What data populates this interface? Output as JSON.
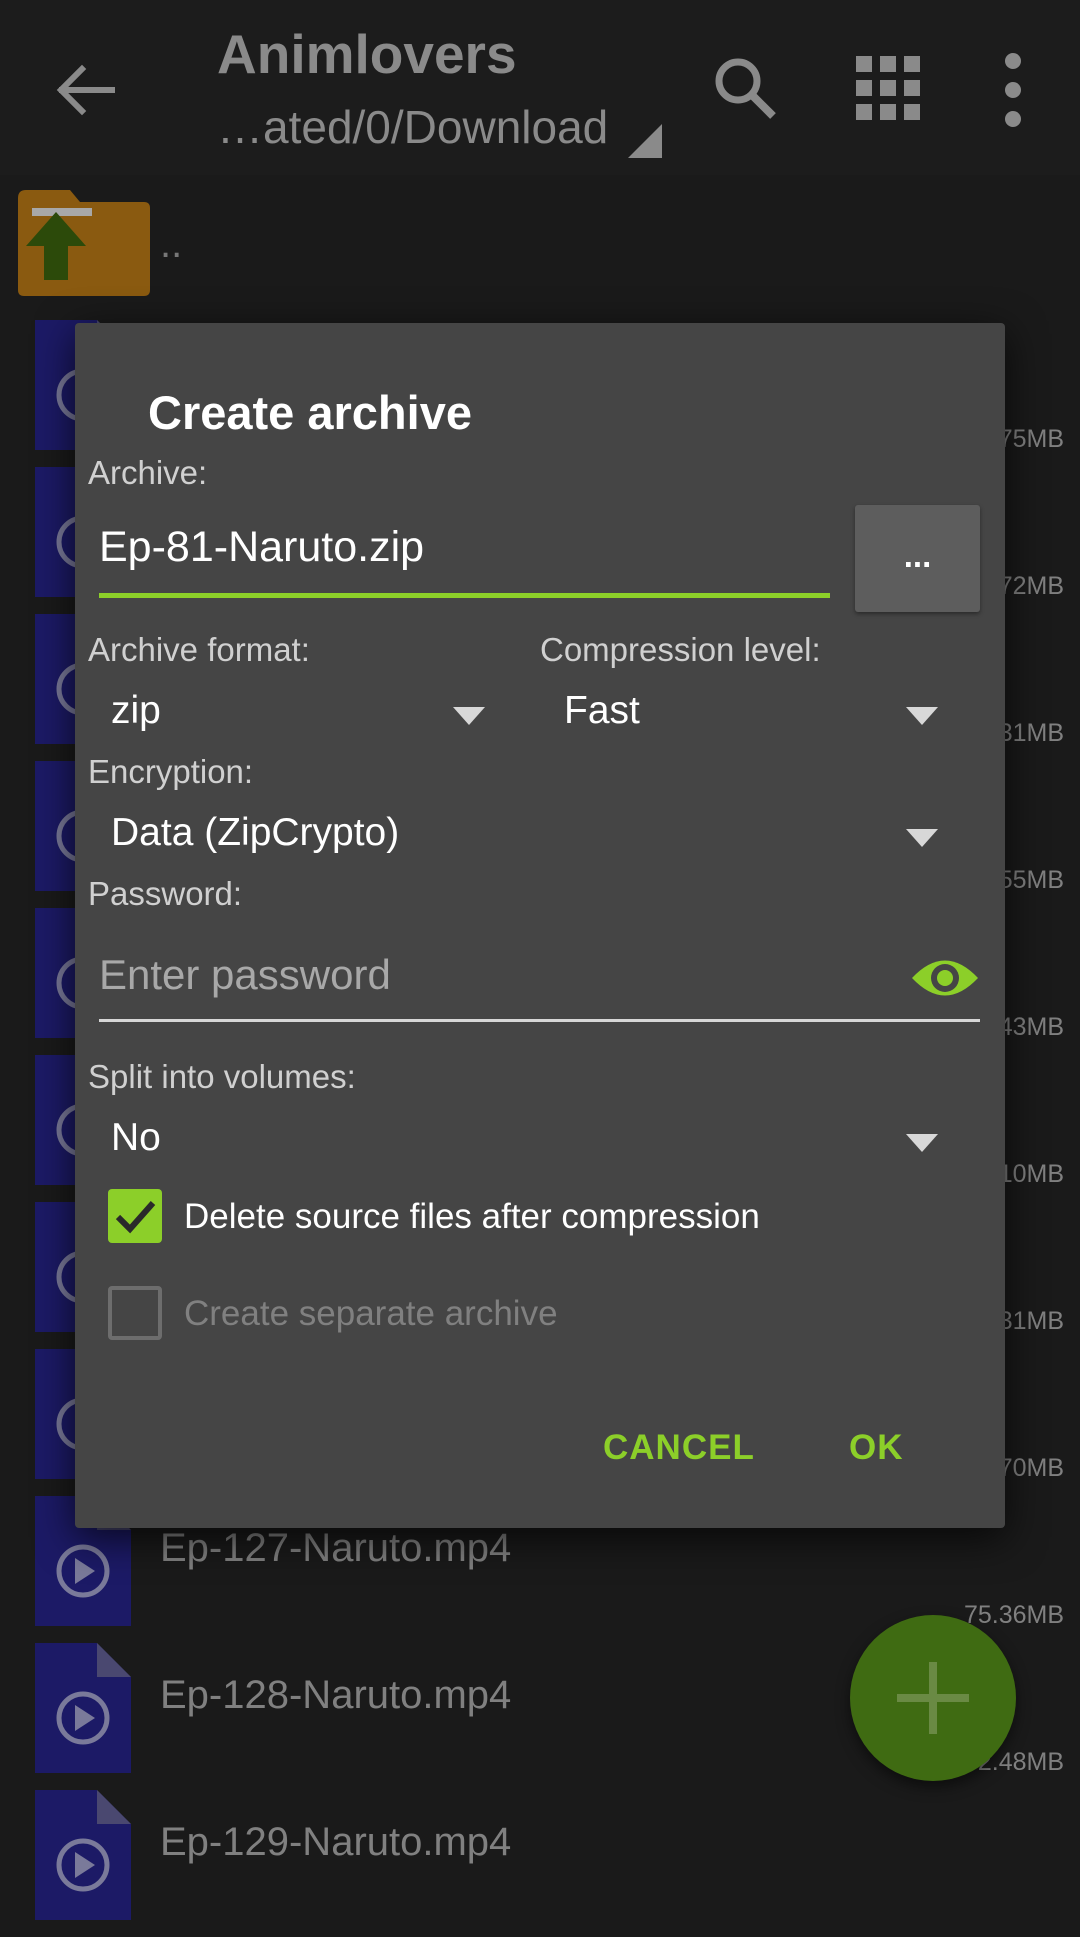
{
  "toolbar": {
    "title": "Animlovers",
    "subtitle": "…ated/0/Download"
  },
  "list": {
    "up_label": "..",
    "files": [
      {
        "name": "",
        "size": "75MB"
      },
      {
        "name": "",
        "size": "72MB"
      },
      {
        "name": "",
        "size": "31MB"
      },
      {
        "name": "",
        "size": "55MB"
      },
      {
        "name": "",
        "size": "43MB"
      },
      {
        "name": "",
        "size": "10MB"
      },
      {
        "name": "",
        "size": "31MB"
      },
      {
        "name": "",
        "size": "70MB"
      },
      {
        "name": "Ep-127-Naruto.mp4",
        "size": "75.36MB"
      },
      {
        "name": "Ep-128-Naruto.mp4",
        "size": "72.48MB"
      },
      {
        "name": "Ep-129-Naruto.mp4",
        "size": ""
      }
    ]
  },
  "dialog": {
    "title": "Create archive",
    "archive_label": "Archive:",
    "archive_value": "Ep-81-Naruto.zip",
    "browse_label": "...",
    "format_label": "Archive format:",
    "format_value": "zip",
    "compression_label": "Compression level:",
    "compression_value": "Fast",
    "encryption_label": "Encryption:",
    "encryption_value": "Data (ZipCrypto)",
    "password_label": "Password:",
    "password_placeholder": "Enter password",
    "split_label": "Split into volumes:",
    "split_value": "No",
    "delete_source_label": "Delete source files after compression",
    "delete_source_checked": true,
    "separate_archive_label": "Create separate archive",
    "separate_archive_checked": false,
    "cancel_label": "CANCEL",
    "ok_label": "OK"
  },
  "colors": {
    "accent": "#8ccf29",
    "dialog_bg": "#454545",
    "background": "#1a1a1a",
    "file_icon": "#1c1a66",
    "fab": "#3f6b12"
  },
  "icons": {
    "back": "arrow-left-icon",
    "search": "search-icon",
    "grid": "grid-view-icon",
    "more": "more-vert-icon",
    "eye": "eye-icon",
    "fab": "plus-icon"
  }
}
